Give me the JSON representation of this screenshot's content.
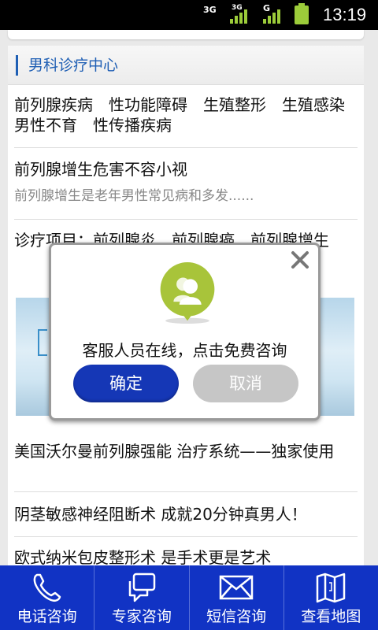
{
  "status_bar": {
    "net1": "3G",
    "net2": "3G",
    "net3": "G",
    "time": "13:19",
    "accent_color": "#9ccc3a"
  },
  "section": {
    "title": "男科诊疗中心"
  },
  "items": {
    "categories": "前列腺疾病　性功能障碍　生殖整形　生殖感染　男性不育　性传播疾病",
    "article1_title": "前列腺增生危害不容小视",
    "article1_summary": "前列腺增生是老年男性常见病和多发......",
    "diagnosis": "诊疗项目：前列腺炎　前列腺癌　前列腺增生",
    "promo1": "美国沃尔曼前列腺强能 治疗系统——独家使用",
    "promo2": "阴茎敏感神经阻断术 成就20分钟真男人！",
    "promo3": "欧式纳米包皮整形术 是手术更是艺术"
  },
  "dialog": {
    "icon": "customer-service-icon",
    "message": "客服人员在线，点击免费咨询",
    "ok_label": "确定",
    "cancel_label": "取消",
    "ok_color": "#1537b6",
    "icon_color": "#a8c43a"
  },
  "bottom_nav": {
    "color": "#1133c4",
    "items": [
      {
        "label": "电话咨询",
        "icon": "phone-icon"
      },
      {
        "label": "专家咨询",
        "icon": "chat-bubbles-icon"
      },
      {
        "label": "短信咨询",
        "icon": "envelope-icon"
      },
      {
        "label": "查看地图",
        "icon": "map-icon"
      }
    ]
  }
}
